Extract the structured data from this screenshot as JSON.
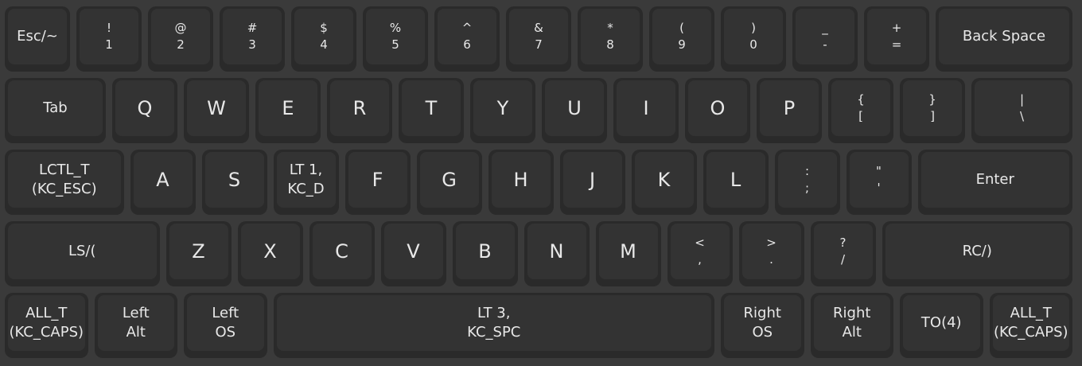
{
  "keyboard": {
    "rows": [
      [
        {
          "type": "single",
          "label": "Esc/~",
          "w": 1
        },
        {
          "type": "sym",
          "top": "!",
          "bottom": "1",
          "w": 1
        },
        {
          "type": "sym",
          "top": "@",
          "bottom": "2",
          "w": 1
        },
        {
          "type": "sym",
          "top": "#",
          "bottom": "3",
          "w": 1
        },
        {
          "type": "sym",
          "top": "$",
          "bottom": "4",
          "w": 1
        },
        {
          "type": "sym",
          "top": "%",
          "bottom": "5",
          "w": 1
        },
        {
          "type": "sym",
          "top": "^",
          "bottom": "6",
          "w": 1
        },
        {
          "type": "sym",
          "top": "&",
          "bottom": "7",
          "w": 1
        },
        {
          "type": "sym",
          "top": "*",
          "bottom": "8",
          "w": 1
        },
        {
          "type": "sym",
          "top": "(",
          "bottom": "9",
          "w": 1
        },
        {
          "type": "sym",
          "top": ")",
          "bottom": "0",
          "w": 1
        },
        {
          "type": "sym",
          "top": "_",
          "bottom": "-",
          "w": 1
        },
        {
          "type": "sym",
          "top": "+",
          "bottom": "=",
          "w": 1
        },
        {
          "type": "single",
          "label": "Back Space",
          "w": 2
        }
      ],
      [
        {
          "type": "single",
          "label": "Tab",
          "w": 1.5
        },
        {
          "type": "letter",
          "label": "Q",
          "w": 1
        },
        {
          "type": "letter",
          "label": "W",
          "w": 1
        },
        {
          "type": "letter",
          "label": "E",
          "w": 1
        },
        {
          "type": "letter",
          "label": "R",
          "w": 1
        },
        {
          "type": "letter",
          "label": "T",
          "w": 1
        },
        {
          "type": "letter",
          "label": "Y",
          "w": 1
        },
        {
          "type": "letter",
          "label": "U",
          "w": 1
        },
        {
          "type": "letter",
          "label": "I",
          "w": 1
        },
        {
          "type": "letter",
          "label": "O",
          "w": 1
        },
        {
          "type": "letter",
          "label": "P",
          "w": 1
        },
        {
          "type": "sym",
          "top": "{",
          "bottom": "[",
          "w": 1
        },
        {
          "type": "sym",
          "top": "}",
          "bottom": "]",
          "w": 1
        },
        {
          "type": "sym",
          "top": "|",
          "bottom": "\\",
          "w": 1.5
        }
      ],
      [
        {
          "type": "two",
          "line1": "LCTL_T",
          "line2": "(KC_ESC)",
          "w": 1.75
        },
        {
          "type": "letter",
          "label": "A",
          "w": 1
        },
        {
          "type": "letter",
          "label": "S",
          "w": 1
        },
        {
          "type": "two",
          "line1": "LT 1,",
          "line2": "KC_D",
          "w": 1
        },
        {
          "type": "letter",
          "label": "F",
          "w": 1
        },
        {
          "type": "letter",
          "label": "G",
          "w": 1
        },
        {
          "type": "letter",
          "label": "H",
          "w": 1
        },
        {
          "type": "letter",
          "label": "J",
          "w": 1
        },
        {
          "type": "letter",
          "label": "K",
          "w": 1
        },
        {
          "type": "letter",
          "label": "L",
          "w": 1
        },
        {
          "type": "sym",
          "top": ":",
          "bottom": ";",
          "w": 1
        },
        {
          "type": "sym",
          "top": "\"",
          "bottom": "'",
          "w": 1
        },
        {
          "type": "single",
          "label": "Enter",
          "w": 2.25
        }
      ],
      [
        {
          "type": "single",
          "label": "LS/(",
          "w": 2.25
        },
        {
          "type": "letter",
          "label": "Z",
          "w": 1
        },
        {
          "type": "letter",
          "label": "X",
          "w": 1
        },
        {
          "type": "letter",
          "label": "C",
          "w": 1
        },
        {
          "type": "letter",
          "label": "V",
          "w": 1
        },
        {
          "type": "letter",
          "label": "B",
          "w": 1
        },
        {
          "type": "letter",
          "label": "N",
          "w": 1
        },
        {
          "type": "letter",
          "label": "M",
          "w": 1
        },
        {
          "type": "sym",
          "top": "<",
          "bottom": ",",
          "w": 1
        },
        {
          "type": "sym",
          "top": ">",
          "bottom": ".",
          "w": 1
        },
        {
          "type": "sym",
          "top": "?",
          "bottom": "/",
          "w": 1
        },
        {
          "type": "single",
          "label": "RC/)",
          "w": 2.75
        }
      ],
      [
        {
          "type": "two",
          "line1": "ALL_T",
          "line2": "(KC_CAPS)",
          "w": 1.25
        },
        {
          "type": "two",
          "line1": "Left",
          "line2": "Alt",
          "w": 1.25
        },
        {
          "type": "two",
          "line1": "Left",
          "line2": "OS",
          "w": 1.25
        },
        {
          "type": "two",
          "line1": "LT 3,",
          "line2": "KC_SPC",
          "w": 6.25
        },
        {
          "type": "two",
          "line1": "Right",
          "line2": "OS",
          "w": 1.25
        },
        {
          "type": "two",
          "line1": "Right",
          "line2": "Alt",
          "w": 1.25
        },
        {
          "type": "single",
          "label": "TO(4)",
          "w": 1.25
        },
        {
          "type": "two",
          "line1": "ALL_T",
          "line2": "(KC_CAPS)",
          "w": 1.25
        }
      ]
    ]
  }
}
